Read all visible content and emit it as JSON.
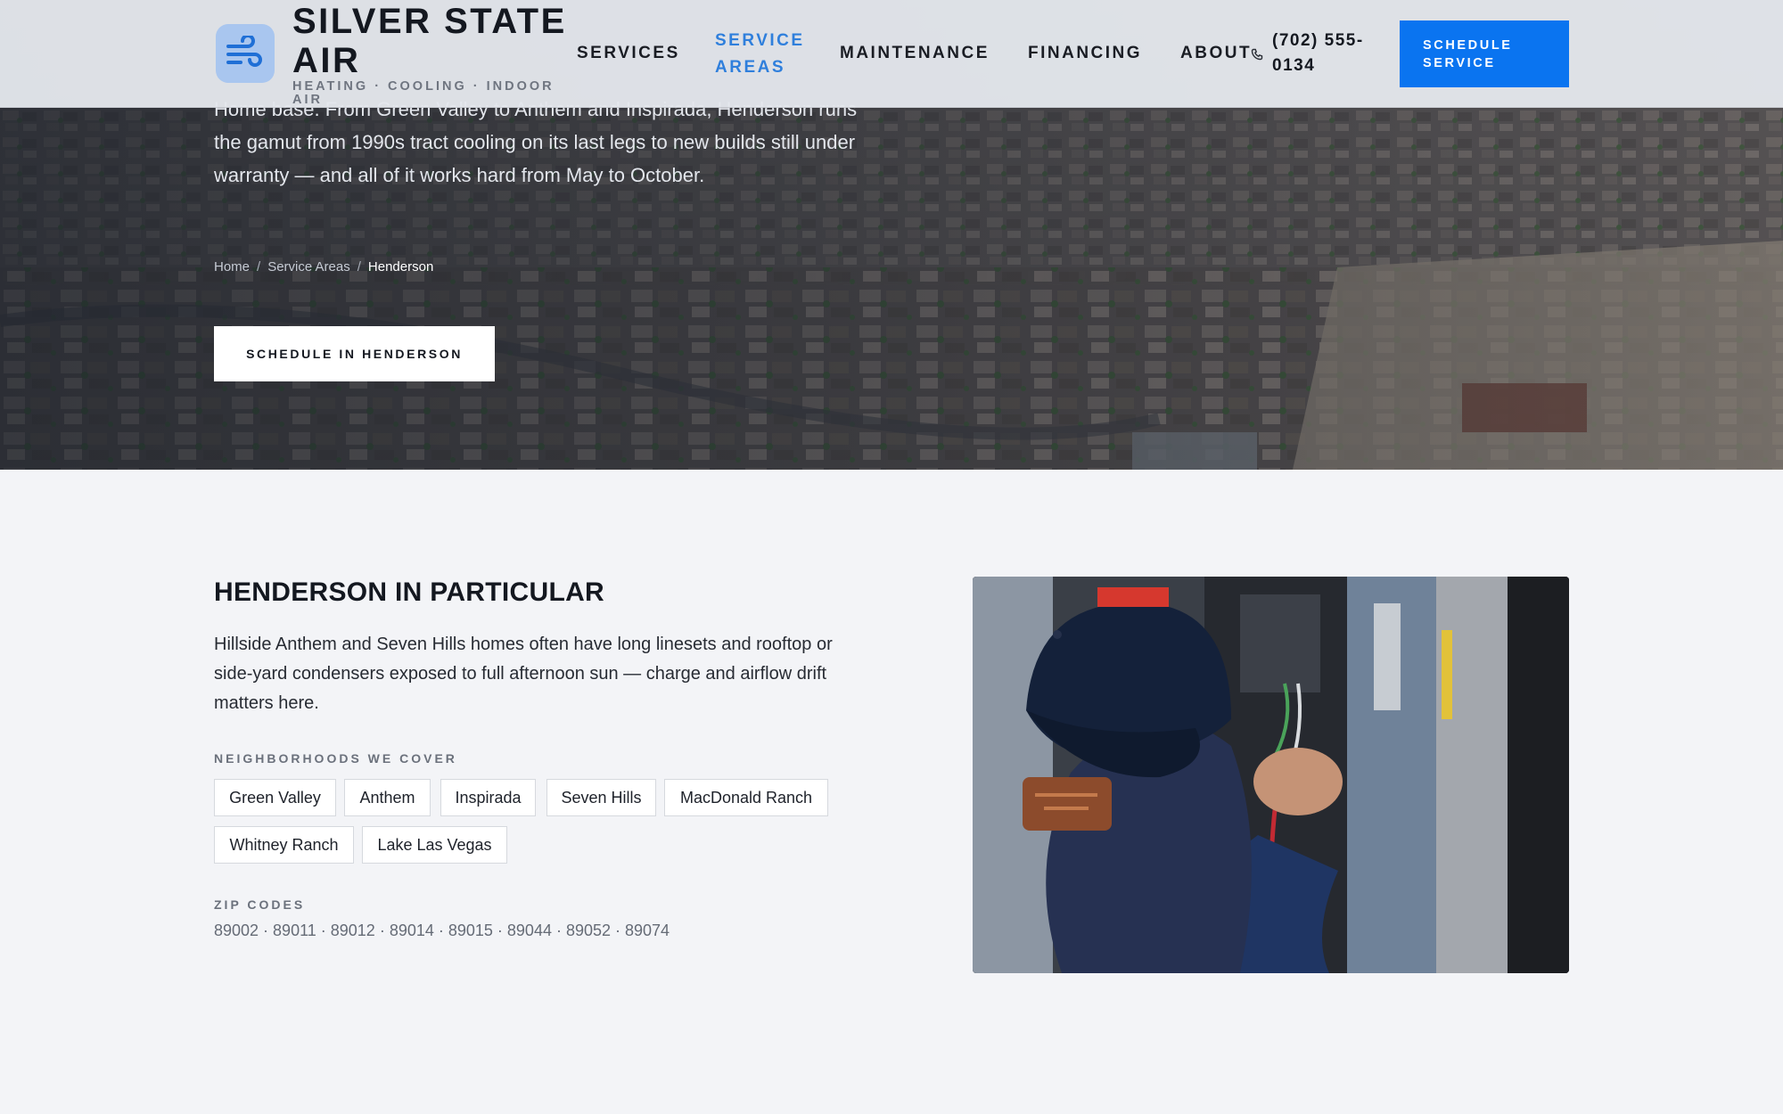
{
  "header": {
    "brand_name": "SILVER STATE AIR",
    "brand_tagline": "HEATING · COOLING · INDOOR AIR",
    "nav": [
      {
        "label": "SERVICES",
        "active": false
      },
      {
        "label": "SERVICE AREAS",
        "active": true
      },
      {
        "label": "MAINTENANCE",
        "active": false
      },
      {
        "label": "FINANCING",
        "active": false
      },
      {
        "label": "ABOUT",
        "active": false
      }
    ],
    "phone": "(702) 555-0134",
    "cta_label": "SCHEDULE SERVICE"
  },
  "hero": {
    "intro": "Home base. From Green Valley to Anthem and Inspirada, Henderson runs the gamut from 1990s tract cooling on its last legs to new builds still under warranty — and all of it works hard from May to October.",
    "breadcrumb": [
      "Home",
      "Service Areas",
      "Henderson"
    ],
    "cta_label": "SCHEDULE IN HENDERSON"
  },
  "particular": {
    "title": "HENDERSON IN PARTICULAR",
    "body": "Hillside Anthem and Seven Hills homes often have long linesets and rooftop or side-yard condensers exposed to full afternoon sun — charge and airflow drift matters here.",
    "neighborhoods_label": "NEIGHBORHOODS WE COVER",
    "neighborhoods": [
      "Green Valley",
      "Anthem",
      "Inspirada",
      "Seven Hills",
      "MacDonald Ranch",
      "Whitney Ranch",
      "Lake Las Vegas"
    ],
    "zip_label": "ZIP CODES",
    "zip_codes": "89002 · 89011 · 89012 · 89014 · 89015 · 89044 · 89052 · 89074"
  },
  "colors": {
    "accent_blue": "#0a74f0",
    "active_nav": "#2f7fdc",
    "page_bg": "#f3f4f7"
  },
  "icons": {
    "logo": "wind-icon",
    "phone": "phone-icon"
  }
}
